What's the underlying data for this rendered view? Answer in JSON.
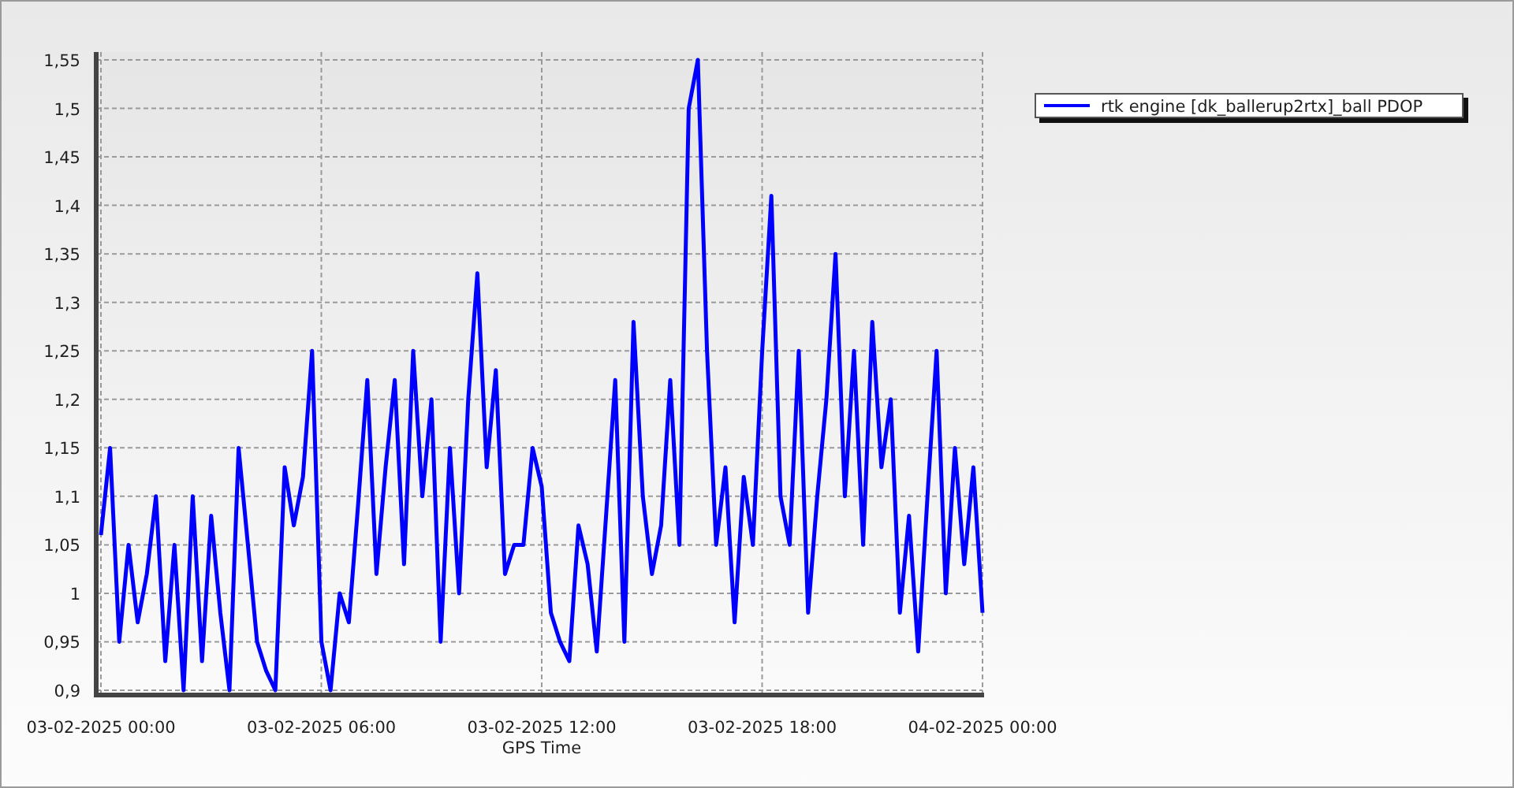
{
  "chart": {
    "chart_data": {
      "type": "line",
      "grid": true,
      "xlabel": "GPS Time",
      "categories": [
        "03-02-2025 00:00",
        null,
        null,
        null,
        null,
        null,
        null,
        null,
        null,
        null,
        null,
        null,
        null,
        null,
        null,
        null,
        null,
        null,
        null,
        null,
        null,
        null,
        null,
        null,
        "03-02-2025 06:00",
        null,
        null,
        null,
        null,
        null,
        null,
        null,
        null,
        null,
        null,
        null,
        null,
        null,
        null,
        null,
        null,
        null,
        null,
        null,
        null,
        null,
        null,
        null,
        "03-02-2025 12:00",
        null,
        null,
        null,
        null,
        null,
        null,
        null,
        null,
        null,
        null,
        null,
        null,
        null,
        null,
        null,
        null,
        null,
        null,
        null,
        null,
        null,
        null,
        null,
        "03-02-2025 18:00",
        null,
        null,
        null,
        null,
        null,
        null,
        null,
        null,
        null,
        null,
        null,
        null,
        null,
        null,
        null,
        null,
        null,
        null,
        null,
        null,
        null,
        null,
        null,
        "04-02-2025 00:00"
      ],
      "ylim": [
        0.9,
        1.55
      ],
      "yticks": [
        {
          "value": 0.9,
          "label": "0,9"
        },
        {
          "value": 0.95,
          "label": "0,95"
        },
        {
          "value": 1,
          "label": "1"
        },
        {
          "value": 1.05,
          "label": "1,05"
        },
        {
          "value": 1.1,
          "label": "1,1"
        },
        {
          "value": 1.15,
          "label": "1,15"
        },
        {
          "value": 1.2,
          "label": "1,2"
        },
        {
          "value": 1.25,
          "label": "1,25"
        },
        {
          "value": 1.3,
          "label": "1,3"
        },
        {
          "value": 1.35,
          "label": "1,35"
        },
        {
          "value": 1.4,
          "label": "1,4"
        },
        {
          "value": 1.45,
          "label": "1,45"
        },
        {
          "value": 1.5,
          "label": "1,5"
        },
        {
          "value": 1.55,
          "label": "1,55"
        }
      ],
      "series": [
        {
          "name": "rtk engine [dk_ballerup2rtx]_ball PDOP",
          "color": "#0000ff",
          "values": [
            1.06,
            1.15,
            0.95,
            1.05,
            0.97,
            1.02,
            1.1,
            0.93,
            1.05,
            0.9,
            1.1,
            0.93,
            1.08,
            0.98,
            0.9,
            1.15,
            1.05,
            0.95,
            0.92,
            0.9,
            1.13,
            1.07,
            1.12,
            1.25,
            0.95,
            0.9,
            1.0,
            0.97,
            1.09,
            1.22,
            1.02,
            1.13,
            1.22,
            1.03,
            1.25,
            1.1,
            1.2,
            0.95,
            1.15,
            1.0,
            1.2,
            1.33,
            1.13,
            1.23,
            1.02,
            1.05,
            1.05,
            1.15,
            1.11,
            0.98,
            0.95,
            0.93,
            1.07,
            1.03,
            0.94,
            1.08,
            1.22,
            0.95,
            1.28,
            1.1,
            1.02,
            1.07,
            1.22,
            1.05,
            1.5,
            1.55,
            1.25,
            1.05,
            1.13,
            0.97,
            1.12,
            1.05,
            1.25,
            1.41,
            1.1,
            1.05,
            1.25,
            0.98,
            1.1,
            1.2,
            1.35,
            1.1,
            1.25,
            1.05,
            1.28,
            1.13,
            1.2,
            0.98,
            1.08,
            0.94,
            1.1,
            1.25,
            1.0,
            1.15,
            1.03,
            1.13,
            0.98
          ]
        }
      ]
    }
  }
}
